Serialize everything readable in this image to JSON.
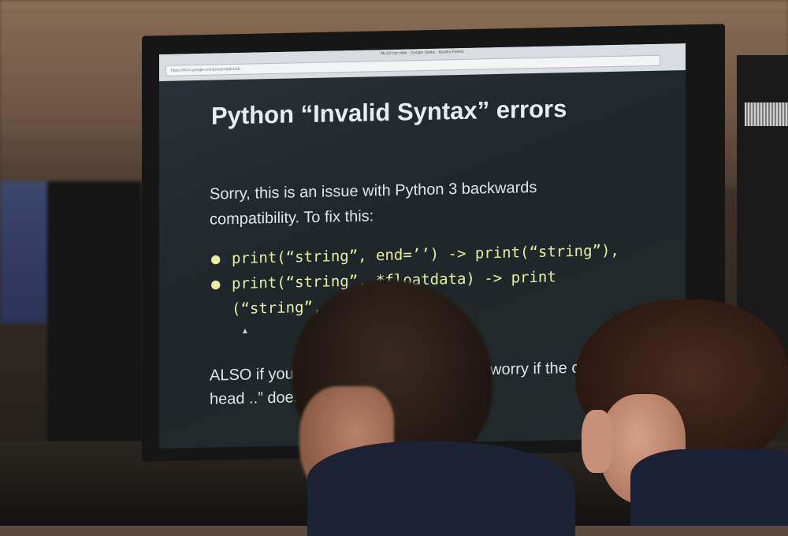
{
  "browser": {
    "window_title": "MLSS lab slide - Google Slides - Mozilla Firefox",
    "url": "https://docs.google.com/presentation/d/..."
  },
  "slide": {
    "title": "Python “Invalid Syntax” errors",
    "intro_line1": "Sorry, this is an issue with Python 3 backwards",
    "intro_line2": "compatibility. To fix this:",
    "bullets": [
      "print(“string”, end=’’) -> print(“string”),",
      "print(“string”, *floatdata) -> print",
      "(“string”, f"
    ],
    "also_line1": "ALSO if you a",
    "also_line1_right": "worry if the cell",
    "also_line2": "head ..” does n"
  }
}
